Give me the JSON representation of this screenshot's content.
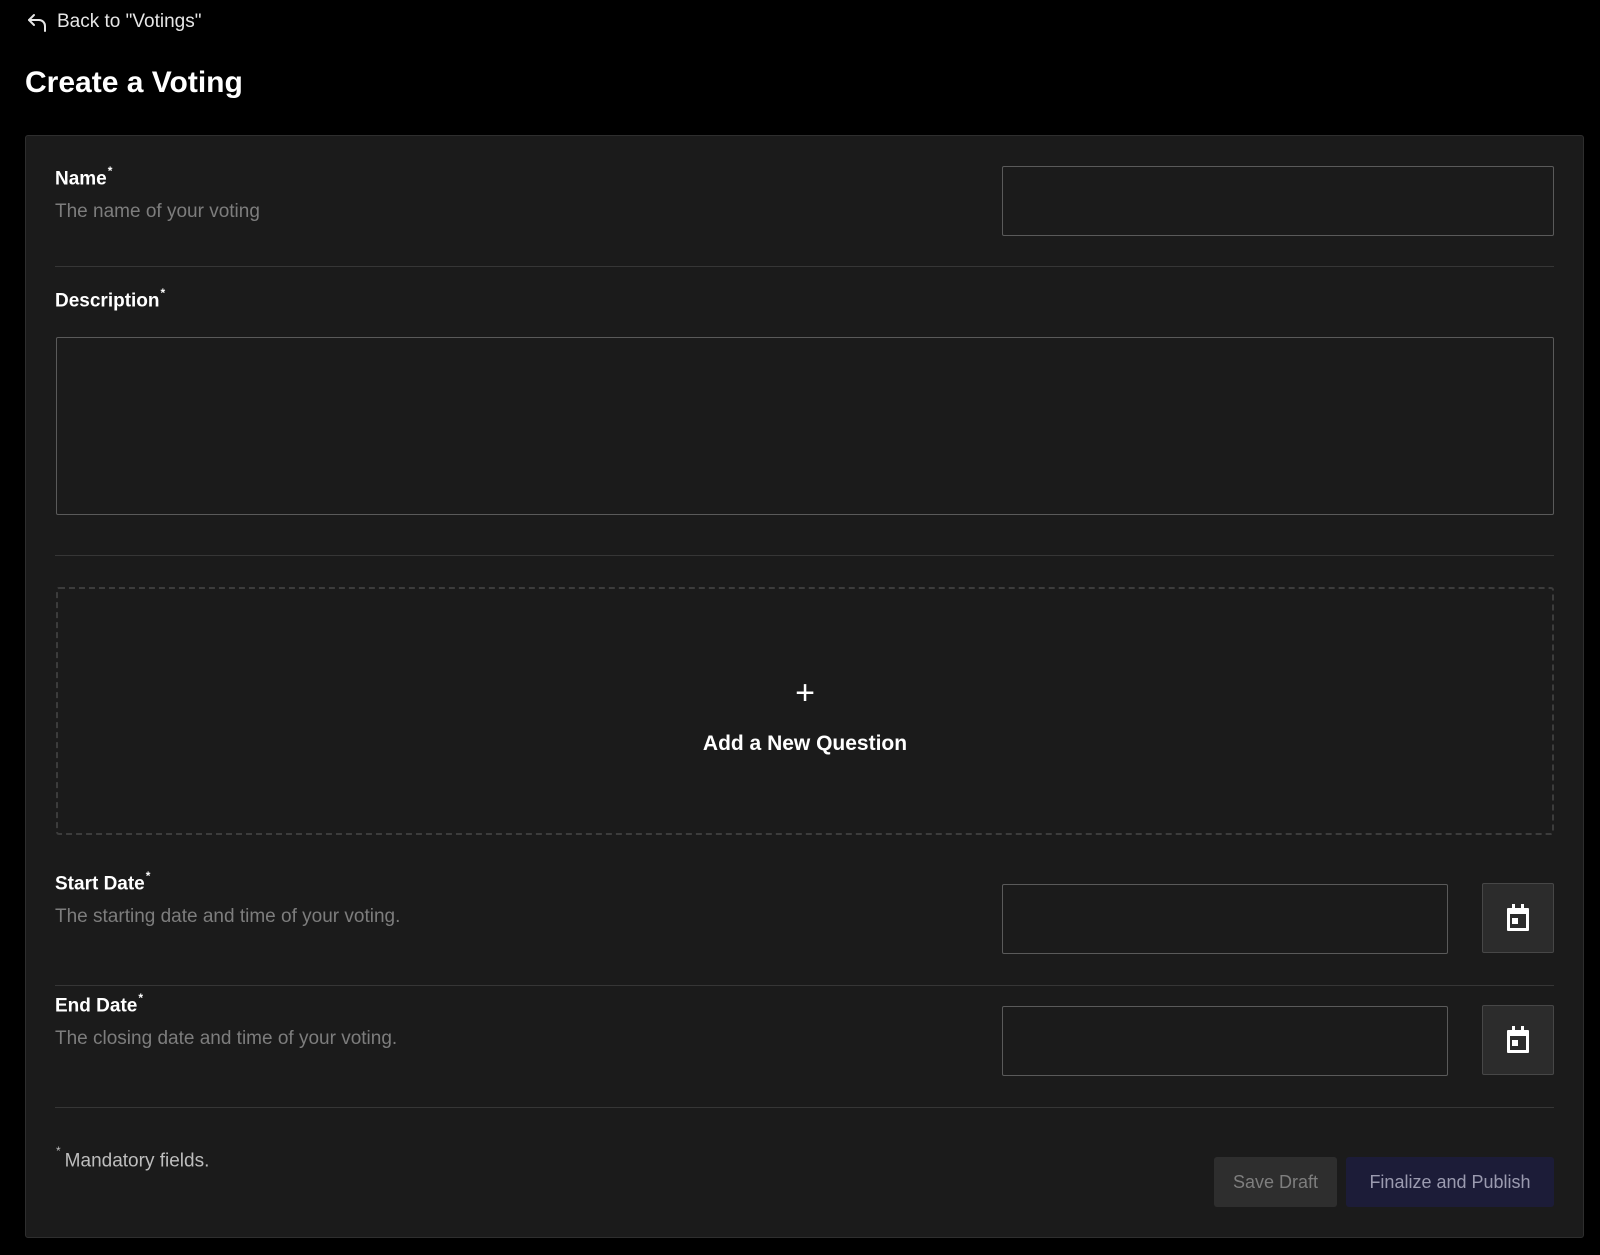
{
  "nav": {
    "back_label": "Back to \"Votings\""
  },
  "page": {
    "title": "Create a Voting"
  },
  "form": {
    "name": {
      "label": "Name",
      "required_mark": "*",
      "hint": "The name of your voting",
      "value": ""
    },
    "description": {
      "label": "Description",
      "required_mark": "*",
      "value": ""
    },
    "add_question": {
      "plus_glyph": "+",
      "label": "Add a New Question"
    },
    "start_date": {
      "label": "Start Date",
      "required_mark": "*",
      "hint": "The starting date and time of your voting.",
      "value": "",
      "icon": "calendar-icon"
    },
    "end_date": {
      "label": "End Date",
      "required_mark": "*",
      "hint": "The closing date and time of your voting.",
      "value": "",
      "icon": "calendar-icon"
    },
    "mandatory_note": {
      "mark": "*",
      "text": "Mandatory fields."
    }
  },
  "actions": {
    "save_draft_label": "Save Draft",
    "publish_label": "Finalize and Publish"
  },
  "colors": {
    "background": "#000000",
    "card": "#1b1b1b",
    "input_border": "#5a5a5a",
    "publish_button": "#1c1c38"
  }
}
